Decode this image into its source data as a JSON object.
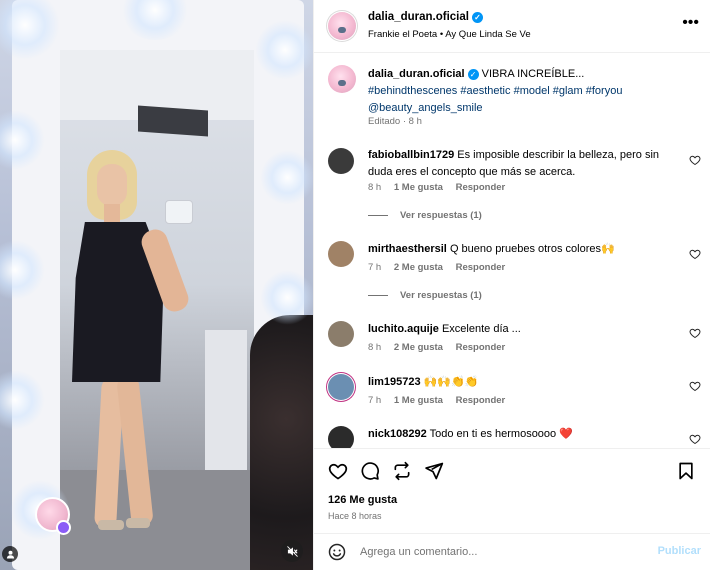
{
  "post": {
    "username": "dalia_duran.oficial",
    "audio": "Frankie el Poeta • Ay Que Linda Se Ve",
    "caption_text": "VIBRA INCREÍBLE...",
    "hashtags": [
      "#behindthescenes",
      "#aesthetic",
      "#model",
      "#glam",
      "#foryou"
    ],
    "mention": "@beauty_angels_smile",
    "edited": "Editado · 8 h",
    "likes": "126 Me gusta",
    "time_ago": "Hace 8 horas"
  },
  "comments": [
    {
      "username": "fabioballbin1729",
      "text": "Es imposible describir la belleza, pero sin duda eres el concepto que más se acerca.",
      "time": "8 h",
      "likes": "1 Me gusta",
      "reply": "Responder",
      "view_replies": "Ver respuestas (1)",
      "avatar_color": "#3a3a3a"
    },
    {
      "username": "mirthaesthersil",
      "text": "Q bueno pruebes otros colores🙌",
      "time": "7 h",
      "likes": "2 Me gusta",
      "reply": "Responder",
      "view_replies": "Ver respuestas (1)",
      "avatar_color": "#a08266"
    },
    {
      "username": "luchito.aquije",
      "text": "Excelente día ...",
      "time": "8 h",
      "likes": "2 Me gusta",
      "reply": "Responder",
      "avatar_color": "#8b7d6b"
    },
    {
      "username": "lim195723",
      "text": "🙌🙌👏👏",
      "time": "7 h",
      "likes": "1 Me gusta",
      "reply": "Responder",
      "avatar_color": "#6b8fb2"
    },
    {
      "username": "nick108292",
      "text": "Todo en ti es hermosoooo ❤️",
      "avatar_color": "#2b2b2b"
    }
  ],
  "comment_bar": {
    "placeholder": "Agrega un comentario...",
    "post_label": "Publicar"
  },
  "icons": {
    "more": "more-options-icon",
    "heart": "heart-icon",
    "comment": "comment-icon",
    "share": "share-icon",
    "send": "send-icon",
    "bookmark": "bookmark-icon",
    "emoji": "emoji-icon",
    "mute": "mute-icon",
    "user": "user-tag-icon"
  },
  "colors": {
    "link": "#00376b",
    "verified": "#0095f6",
    "muted_text": "#737373",
    "post_button_disabled": "#b2dffc"
  }
}
